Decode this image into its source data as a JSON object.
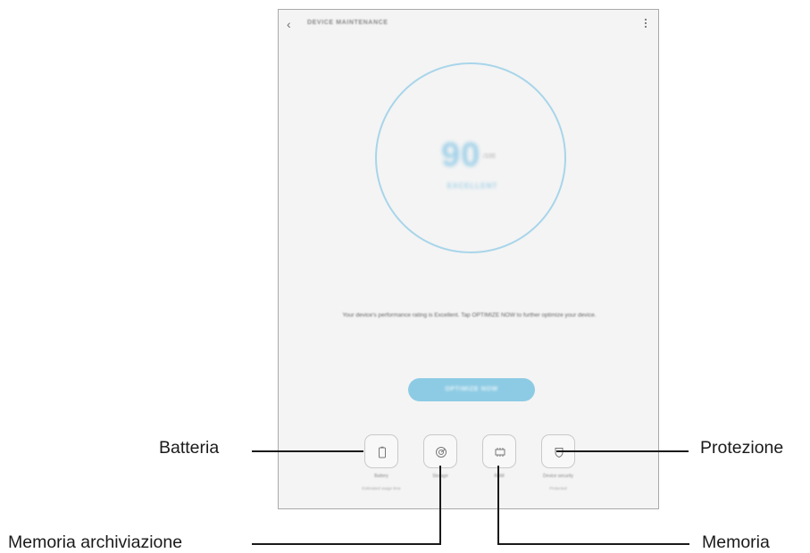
{
  "header": {
    "title": "DEVICE MAINTENANCE"
  },
  "status": {
    "score": "90",
    "unit": "/100",
    "rating": "EXCELLENT"
  },
  "description": "Your device's performance rating is Excellent. Tap OPTIMIZE NOW to further optimize your device.",
  "optimize_button": "OPTIMIZE NOW",
  "tiles": [
    {
      "label": "Battery",
      "sub": "Estimated usage time"
    },
    {
      "label": "Storage",
      "sub": ""
    },
    {
      "label": "RAM",
      "sub": ""
    },
    {
      "label": "Device security",
      "sub": "Protected"
    }
  ],
  "callouts": {
    "battery": "Batteria",
    "storage": "Memoria archiviazione",
    "memory": "Memoria",
    "security": "Protezione"
  },
  "colors": {
    "accent": "#8dcbe4",
    "ring": "#a8d5ea",
    "device_bg": "#f4f4f4"
  }
}
